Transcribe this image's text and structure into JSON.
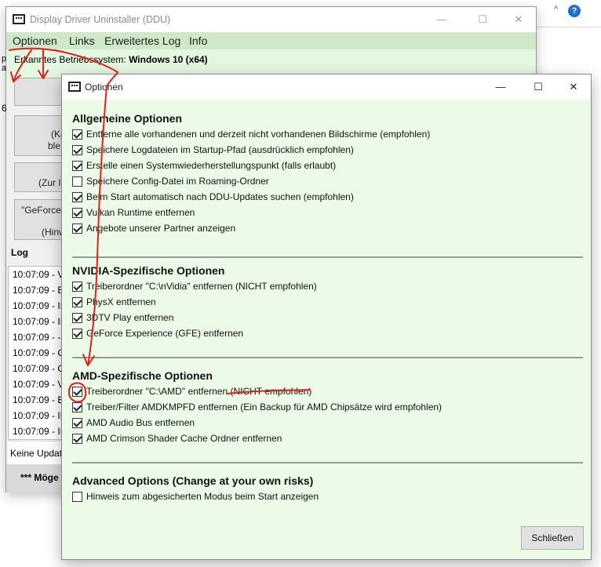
{
  "background": {
    "chevron": "^",
    "help": "?"
  },
  "main_window": {
    "title": "Display Driver Uninstaller (DDU)",
    "menu": [
      "Optionen",
      "Links",
      "Erweitertes Log",
      "Info"
    ],
    "os_label": "Erkanntes Betriebssystem:",
    "os_value": "Windows 10 (x64)",
    "side_fragment": "6",
    "left_fragments": [
      "p",
      "a"
    ],
    "buttons": [
      {
        "line1": "(Ka",
        "line2": "ble"
      },
      {
        "line1": "(Zur I",
        "line2": ""
      },
      {
        "line1": "\"GeForce",
        "line2": "(Hinw"
      }
    ],
    "log_label": "Log",
    "log_rows": [
      "10:07:09 - V",
      "10:07:09 - E",
      "10:07:09 - IN",
      "10:07:09 - IN",
      "10:07:09 - --",
      "10:07:09 - G",
      "10:07:09 - G",
      "10:07:09 - V",
      "10:07:09 - E",
      "10:07:09 - IN",
      "10:07:09 - IN"
    ],
    "status_text": "Keine Updat",
    "notice_text": "*** Möge"
  },
  "options_dialog": {
    "title": "Optionen",
    "sections": [
      {
        "heading": "Allgemeine Optionen",
        "options": [
          {
            "label": "Entferne alle vorhandenen und derzeit nicht vorhandenen Bildschirme (empfohlen)",
            "checked": true
          },
          {
            "label": "Speichere Logdateien im Startup-Pfad (ausdrücklich empfohlen)",
            "checked": true
          },
          {
            "label": "Erstelle einen Systemwiederherstellungspunkt (falls erlaubt)",
            "checked": true
          },
          {
            "label": "Speichere Config-Datei im Roaming-Ordner",
            "checked": false
          },
          {
            "label": "Beim Start automatisch nach DDU-Updates suchen (empfohlen)",
            "checked": true
          },
          {
            "label": "Vulkan Runtime entfernen",
            "checked": true
          },
          {
            "label": "Angebote unserer Partner anzeigen",
            "checked": true
          }
        ]
      },
      {
        "heading": "NVIDIA-Spezifische Optionen",
        "options": [
          {
            "label": "Treiberordner \"C:\\nVidia\" entfernen (NICHT empfohlen)",
            "checked": true
          },
          {
            "label": "PhysX entfernen",
            "checked": true
          },
          {
            "label": "3DTV Play entfernen",
            "checked": true
          },
          {
            "label": "GeForce Experience (GFE) entfernen",
            "checked": true
          }
        ]
      },
      {
        "heading": "AMD-Spezifische Optionen",
        "options": [
          {
            "label": "Treiberordner \"C:\\AMD\" entfernen (NICHT empfohlen)",
            "checked": true
          },
          {
            "label": "Treiber/Filter AMDKMPFD entfernen (Ein Backup für AMD Chipsätze wird empfohlen)",
            "checked": true
          },
          {
            "label": "AMD Audio Bus entfernen",
            "checked": true
          },
          {
            "label": "AMD Crimson Shader Cache Ordner entfernen",
            "checked": true
          }
        ]
      },
      {
        "heading": "Advanced Options (Change at your own risks)",
        "options": [
          {
            "label": "Hinweis zum abgesicherten Modus beim Start anzeigen",
            "checked": false
          }
        ]
      }
    ],
    "close_button": "Schließen"
  },
  "window_controls": {
    "minimize": "—",
    "maximize": "☐",
    "close": "✕"
  },
  "colors": {
    "menubar_green": "#cfe8c8",
    "dialog_bg": "#ecfbe8",
    "annotation_red": "#e0201b"
  }
}
